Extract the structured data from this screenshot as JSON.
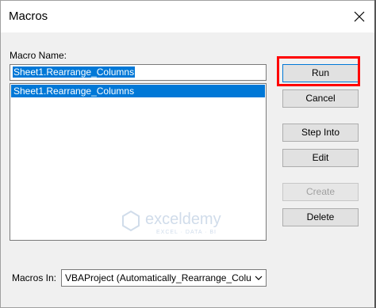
{
  "window": {
    "title": "Macros"
  },
  "macro_name": {
    "label": "Macro Name:",
    "value": "Sheet1.Rearrange_Columns"
  },
  "macro_list": [
    {
      "name": "Sheet1.Rearrange_Columns",
      "selected": true
    }
  ],
  "buttons": {
    "run": "Run",
    "cancel": "Cancel",
    "step_into": "Step Into",
    "edit": "Edit",
    "create": "Create",
    "delete": "Delete"
  },
  "macros_in": {
    "label": "Macros In:",
    "value": "VBAProject (Automatically_Rearrange_Colu"
  },
  "watermark": {
    "brand": "exceldemy",
    "tagline": "EXCEL · DATA · BI"
  },
  "colors": {
    "selection": "#0078d7",
    "highlight": "#ff0000"
  }
}
